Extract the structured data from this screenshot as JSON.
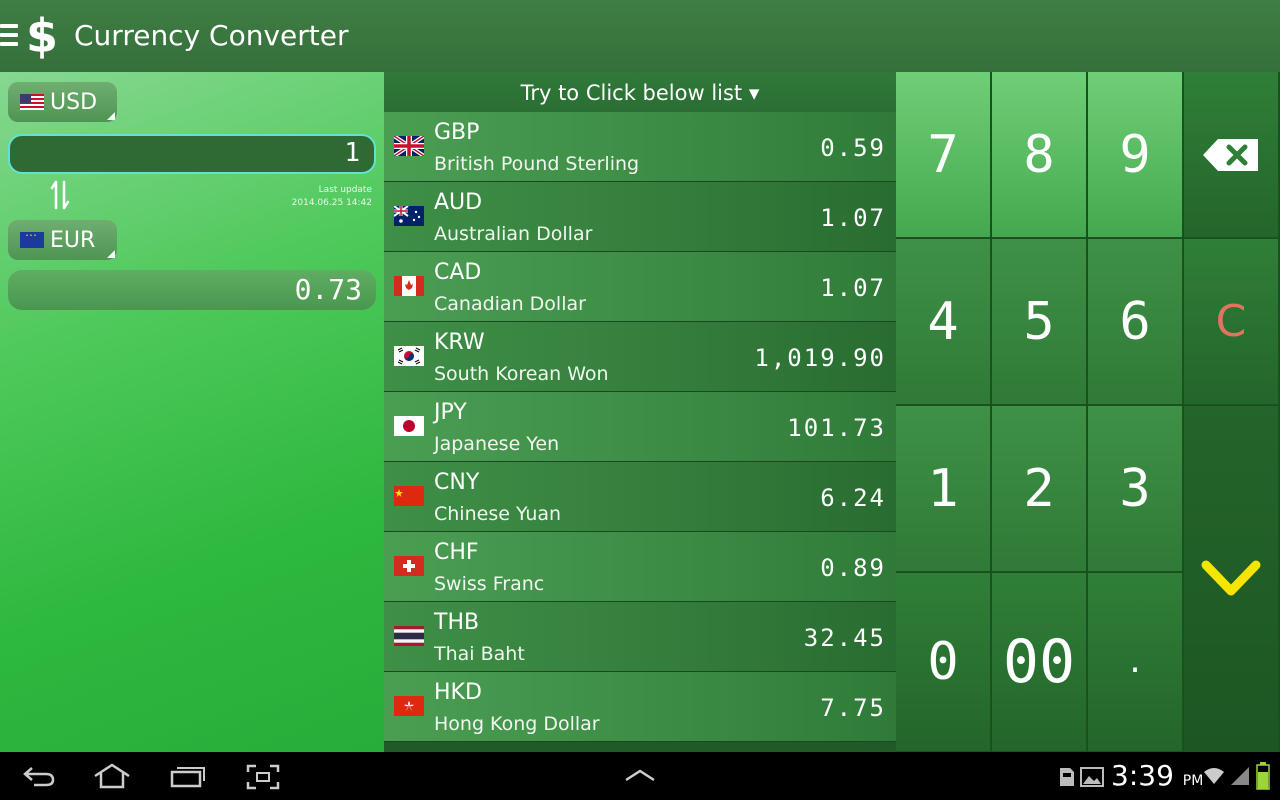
{
  "app": {
    "title": "Currency Converter",
    "menu_icon": "menu-icon",
    "logo_icon": "dollar-icon",
    "logo_glyph": "$"
  },
  "left": {
    "from_currency": "USD",
    "to_currency": "EUR",
    "amount": "1",
    "result": "0.73",
    "last_update_label": "Last update",
    "last_update_value": "2014.06.25 14:42"
  },
  "list": {
    "header": "Try to Click below list ▾",
    "items": [
      {
        "code": "GBP",
        "name": "British Pound Sterling",
        "value": "0.59",
        "flag": "gb-flag-icon"
      },
      {
        "code": "AUD",
        "name": "Australian Dollar",
        "value": "1.07",
        "flag": "au-flag-icon"
      },
      {
        "code": "CAD",
        "name": "Canadian Dollar",
        "value": "1.07",
        "flag": "ca-flag-icon"
      },
      {
        "code": "KRW",
        "name": "South Korean Won",
        "value": "1,019.90",
        "flag": "kr-flag-icon"
      },
      {
        "code": "JPY",
        "name": "Japanese Yen",
        "value": "101.73",
        "flag": "jp-flag-icon"
      },
      {
        "code": "CNY",
        "name": "Chinese Yuan",
        "value": "6.24",
        "flag": "cn-flag-icon"
      },
      {
        "code": "CHF",
        "name": "Swiss Franc",
        "value": "0.89",
        "flag": "ch-flag-icon"
      },
      {
        "code": "THB",
        "name": "Thai Baht",
        "value": "32.45",
        "flag": "th-flag-icon"
      },
      {
        "code": "HKD",
        "name": "Hong Kong Dollar",
        "value": "7.75",
        "flag": "hk-flag-icon"
      }
    ]
  },
  "keypad": {
    "k7": "7",
    "k8": "8",
    "k9": "9",
    "k4": "4",
    "k5": "5",
    "k6": "6",
    "k1": "1",
    "k2": "2",
    "k3": "3",
    "k0": "0",
    "k00": "00",
    "kdot": ".",
    "clear": "C",
    "backspace_icon": "backspace-icon",
    "confirm_icon": "checkmark-icon"
  },
  "system": {
    "time": "3:39",
    "ampm": "PM"
  },
  "colors": {
    "accent_green": "#4fc95b",
    "clear_red": "#e2735f",
    "confirm_yellow": "#f5e600"
  }
}
